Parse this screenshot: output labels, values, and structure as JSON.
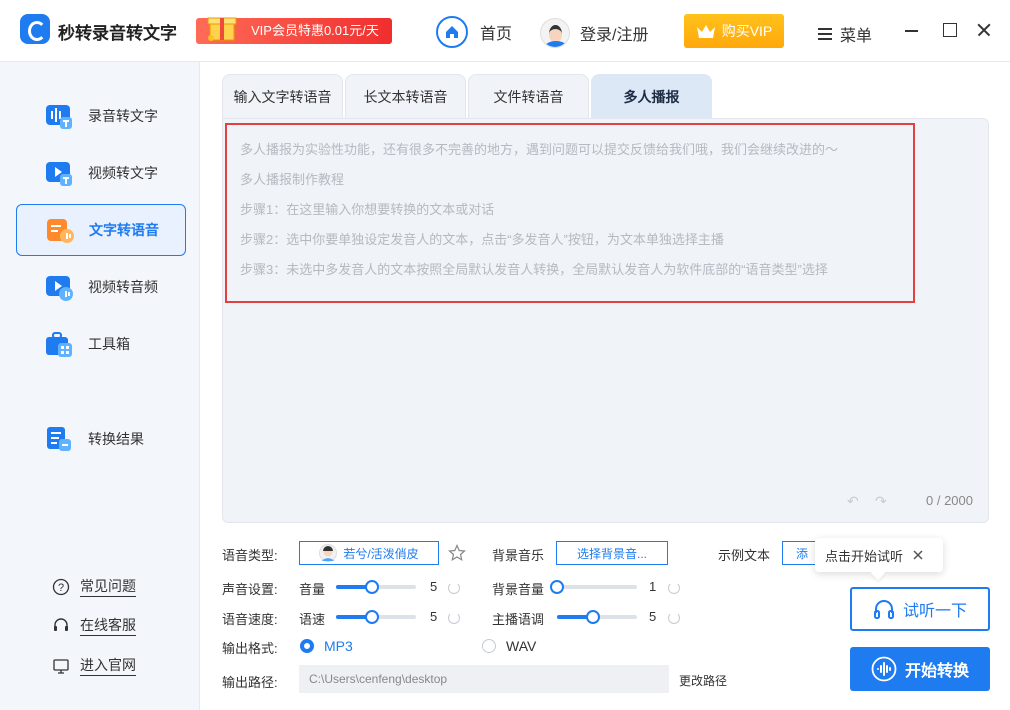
{
  "app": {
    "title": "秒转录音转文字",
    "vip_promo": "VIP会员特惠0.01元/天"
  },
  "header": {
    "home": "首页",
    "login": "登录/注册",
    "buy_vip": "购买VIP",
    "menu": "菜单"
  },
  "sidebar": {
    "items": [
      {
        "label": "录音转文字",
        "icon": "audio-to-text-icon"
      },
      {
        "label": "视频转文字",
        "icon": "video-to-text-icon"
      },
      {
        "label": "文字转语音",
        "icon": "text-to-speech-icon",
        "active": true
      },
      {
        "label": "视频转音频",
        "icon": "video-to-audio-icon"
      },
      {
        "label": "工具箱",
        "icon": "toolbox-icon"
      },
      {
        "label": "转换结果",
        "icon": "results-icon"
      }
    ],
    "footer": [
      {
        "label": "常见问题",
        "icon": "question-icon"
      },
      {
        "label": "在线客服",
        "icon": "headset-icon"
      },
      {
        "label": "进入官网",
        "icon": "monitor-icon"
      }
    ]
  },
  "tabs": [
    {
      "label": "输入文字转语音"
    },
    {
      "label": "长文本转语音"
    },
    {
      "label": "文件转语音"
    },
    {
      "label": "多人播报",
      "active": true
    }
  ],
  "editor": {
    "hint_lines": [
      "多人播报为实验性功能，还有很多不完善的地方，遇到问题可以提交反馈给我们哦，我们会继续改进的～",
      "多人播报制作教程",
      "步骤1：在这里输入你想要转换的文本或对话",
      "步骤2：选中你要单独设定发音人的文本，点击“多发音人”按钮，为文本单独选择主播",
      "步骤3：未选中多发音人的文本按照全局默认发音人转换，全局默认发音人为软件底部的“语音类型”选择"
    ],
    "char_count": "0 / 2000"
  },
  "settings": {
    "voice_type_label": "语音类型:",
    "voice_name": "若兮/活泼俏皮",
    "bgm_label": "背景音乐",
    "bgm_button": "选择背景音...",
    "sample_label": "示例文本",
    "sample_button": "添",
    "sound_label": "声音设置:",
    "volume_label": "音量",
    "volume_value": 5,
    "bg_volume_label": "背景音量",
    "bg_volume_value": 1,
    "speed_label": "语音速度:",
    "speed_sub_label": "语速",
    "speed_value": 5,
    "pitch_label": "主播语调",
    "pitch_value": 5,
    "format_label": "输出格式:",
    "format_options": [
      "MP3",
      "WAV"
    ],
    "format_selected": "MP3",
    "path_label": "输出路径:",
    "path_value": "C:\\Users\\cenfeng\\desktop",
    "change_path": "更改路径"
  },
  "actions": {
    "tooltip": "点击开始试听",
    "preview": "试听一下",
    "start": "开始转换"
  },
  "colors": {
    "accent": "#1e7bf0",
    "vip": "#ffa80b",
    "promo": "#f02e2e",
    "highlight_box": "#e34040"
  }
}
